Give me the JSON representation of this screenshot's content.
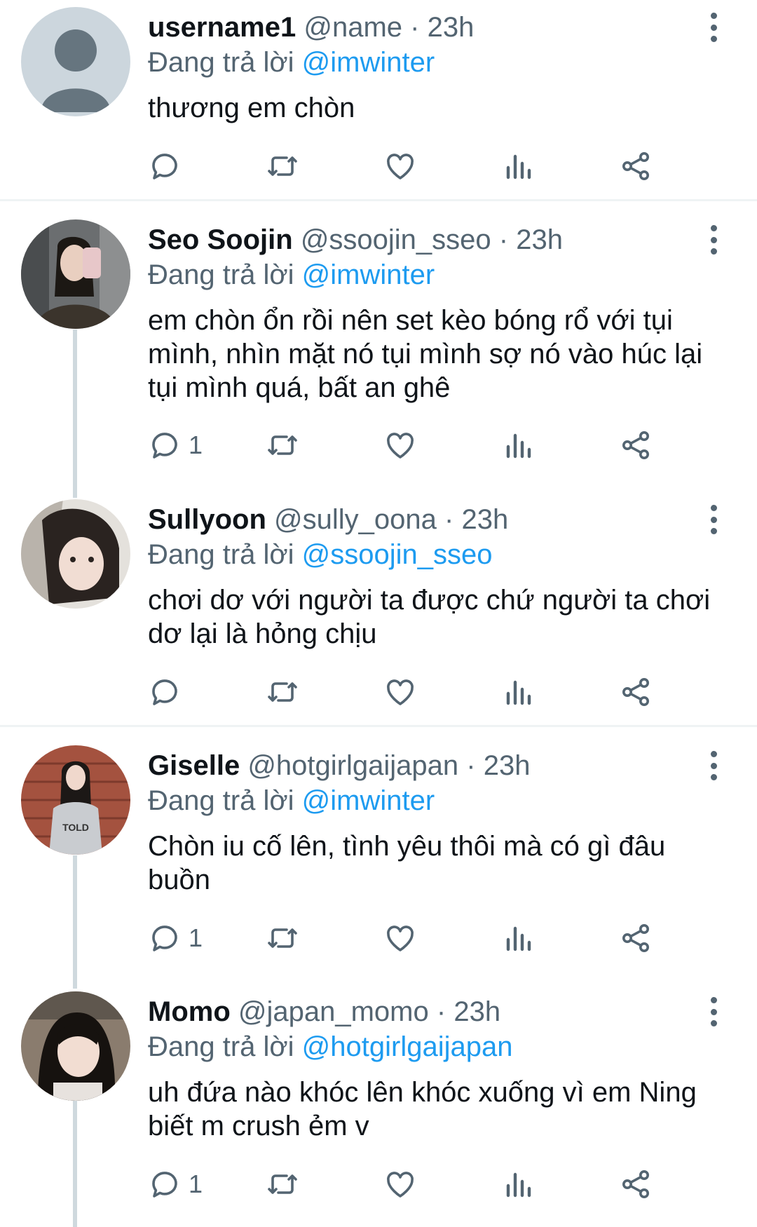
{
  "reply_prefix": "Đang trả lời",
  "separator": "·",
  "colors": {
    "link": "#1d9bf0",
    "muted": "#536471",
    "text": "#0f1419",
    "divider": "#eff3f4"
  },
  "tweets": [
    {
      "display_name": "username1",
      "handle": "@name",
      "time": "23h",
      "reply_to": "@imwinter",
      "text": "thương em chòn",
      "reply_count": "",
      "avatar": "default-avatar"
    },
    {
      "display_name": "Seo Soojin",
      "handle": "@ssoojin_sseo",
      "time": "23h",
      "reply_to": "@imwinter",
      "text": "em chòn ổn rồi nên set kèo bóng rổ với tụi mình, nhìn mặt nó tụi mình sợ nó vào húc lại tụi mình quá, bất an ghê",
      "reply_count": "1",
      "avatar": "photo-avatar"
    },
    {
      "display_name": "Sullyoon",
      "handle": "@sully_oona",
      "time": "23h",
      "reply_to": "@ssoojin_sseo",
      "text": "chơi dơ với người ta được chứ người ta chơi dơ lại là hỏng chịu",
      "reply_count": "",
      "avatar": "photo-avatar"
    },
    {
      "display_name": "Giselle",
      "handle": "@hotgirlgaijapan",
      "time": "23h",
      "reply_to": "@imwinter",
      "text": "Chòn iu cố lên, tình yêu thôi mà có gì đâu buồn",
      "reply_count": "1",
      "avatar": "photo-avatar"
    },
    {
      "display_name": "Momo",
      "handle": "@japan_momo",
      "time": "23h",
      "reply_to": "@hotgirlgaijapan",
      "text": "uh đứa nào khóc lên khóc xuống vì em Ning biết m crush ẻm v",
      "reply_count": "1",
      "avatar": "photo-avatar"
    }
  ]
}
